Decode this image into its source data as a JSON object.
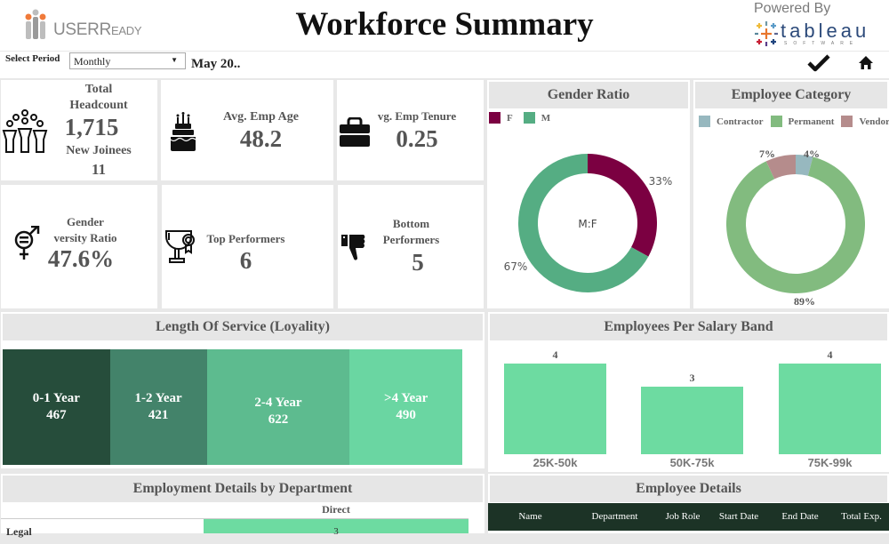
{
  "header": {
    "brand_name": "USER",
    "brand_suffix": "EADY",
    "brand_initial": "R",
    "title": "Workforce Summary",
    "powered_by": "Powered By",
    "partner_logo": "tableau",
    "partner_sub": "SOFTWARE"
  },
  "filters": {
    "select_period_label": "Select Period",
    "period_value": "Monthly",
    "period_display": "May 20..",
    "check_icon": "check-icon",
    "home_icon": "home-icon"
  },
  "kpis": {
    "headcount": {
      "label_line1": "Total",
      "label_line2": "Headcount",
      "value": "1,715",
      "sub_label": "New Joinees",
      "sub_value": "11",
      "icon": "people-group-icon"
    },
    "avg_age": {
      "label": "Avg. Emp Age",
      "value": "48.2",
      "icon": "birthday-cake-icon"
    },
    "avg_tenure": {
      "label": "vg. Emp Tenure",
      "value": "0.25",
      "icon": "briefcase-icon"
    },
    "gender_diversity": {
      "label_line1": "Gender",
      "label_line2": "versity Ratio",
      "value": "47.6%",
      "icon": "gender-equality-icon"
    },
    "top_performers": {
      "label": "Top Performers",
      "value": "6",
      "icon": "trophy-icon"
    },
    "bottom_performers": {
      "label_line1": "Bottom",
      "label_line2": "Performers",
      "value": "5",
      "icon": "thumbs-down-icon"
    }
  },
  "gender_ratio": {
    "title": "Gender Ratio",
    "center_label": "M:F",
    "legend": [
      {
        "label": "F",
        "color": "#7b0041"
      },
      {
        "label": "M",
        "color": "#55ad83"
      }
    ]
  },
  "employee_category": {
    "title": "Employee Category",
    "legend": [
      {
        "label": "Contractor",
        "color": "#97b8bf"
      },
      {
        "label": "Permanent",
        "color": "#82bb7f"
      },
      {
        "label": "Vendor",
        "color": "#b58c8c"
      }
    ]
  },
  "length_of_service": {
    "title": "Length Of Service (Loyality)",
    "segments": [
      {
        "label": "0-1 Year",
        "value": "467",
        "color": "#264d3b"
      },
      {
        "label": "1-2 Year",
        "value": "421",
        "color": "#43836a"
      },
      {
        "label": "2-4 Year",
        "value": "622",
        "color": "#5dbb8f"
      },
      {
        "label": ">4 Year",
        "value": "490",
        "color": "#6ad6a2"
      }
    ]
  },
  "salary_band": {
    "title": "Employees Per Salary Band"
  },
  "dept_details": {
    "title": "Employment Details by Department",
    "column_header": "Direct",
    "rows": [
      {
        "department": "Legal",
        "direct": "3"
      }
    ]
  },
  "employee_details": {
    "title": "Employee Details",
    "columns": [
      "Name",
      "Department",
      "Job Role",
      "Start Date",
      "End Date",
      "Total Exp."
    ]
  },
  "chart_data": [
    {
      "type": "pie",
      "title": "Gender Ratio",
      "donut": true,
      "categories": [
        "F",
        "M"
      ],
      "values": [
        33,
        67
      ],
      "labels": [
        "33%",
        "67%"
      ],
      "colors": [
        "#7b0041",
        "#55ad83"
      ],
      "center_label": "M:F",
      "legend": "top-left"
    },
    {
      "type": "pie",
      "title": "Employee Category",
      "donut": true,
      "categories": [
        "Contractor",
        "Permanent",
        "Vendor"
      ],
      "values": [
        4,
        89,
        7
      ],
      "labels": [
        "4%",
        "89%",
        "7%"
      ],
      "colors": [
        "#97b8bf",
        "#82bb7f",
        "#b58c8c"
      ],
      "legend": "top"
    },
    {
      "type": "bar",
      "title": "Length Of Service (Loyality)",
      "orientation": "stacked-horizontal",
      "categories": [
        "0-1 Year",
        "1-2 Year",
        "2-4 Year",
        ">4 Year"
      ],
      "values": [
        467,
        421,
        622,
        490
      ]
    },
    {
      "type": "bar",
      "title": "Employees Per Salary Band",
      "categories": [
        "25K-50k",
        "50K-75k",
        "75K-99k"
      ],
      "values": [
        4,
        3,
        4
      ],
      "xlabel": "",
      "ylabel": "",
      "ylim": [
        0,
        4
      ],
      "grid": false,
      "color": "#6ddba1"
    }
  ]
}
